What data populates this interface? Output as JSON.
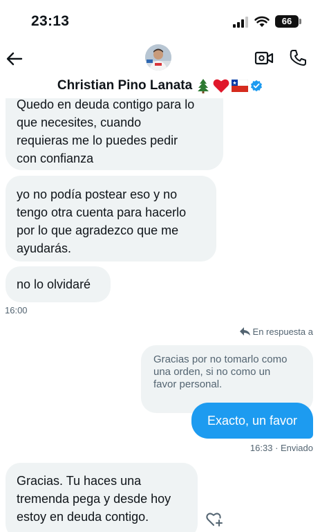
{
  "status_bar": {
    "time": "23:13",
    "battery": "66",
    "icons": [
      "signal-icon",
      "wifi-icon",
      "battery-icon"
    ]
  },
  "header": {
    "back_icon": "back-arrow-icon",
    "contact_name": "Christian Pino Lanata",
    "name_emojis": "🌲❤️🇨🇱",
    "verified_icon": "verified-badge-icon",
    "video_icon": "video-camera-icon",
    "phone_icon": "phone-icon"
  },
  "messages": [
    {
      "direction": "in",
      "lines": [
        "Quedo en deuda contigo para lo",
        "que necesites, cuando",
        "requieras me lo puedes pedir",
        "con confianza"
      ]
    },
    {
      "direction": "in",
      "lines": [
        "yo no podía postear eso y no",
        "tengo otra cuenta para hacerlo",
        "por lo que agradezco que me",
        "ayudarás."
      ]
    },
    {
      "direction": "in",
      "lines": [
        "no lo olvidaré"
      ],
      "time": "16:00"
    },
    {
      "direction": "out",
      "reply_label": "En respuesta a",
      "quoted_lines": [
        "Gracias por no tomarlo como",
        "una orden, si no como un",
        "favor personal."
      ],
      "text": "Exacto, un favor",
      "meta": "16:33 · Enviado"
    },
    {
      "direction": "in",
      "lines": [
        "Gracias. Tu haces una",
        "tremenda pega y desde hoy",
        "estoy en deuda contigo."
      ]
    }
  ],
  "colors": {
    "accent": "#1d9bf0",
    "incoming_bubble": "#eff3f4",
    "muted_text": "#536471"
  }
}
